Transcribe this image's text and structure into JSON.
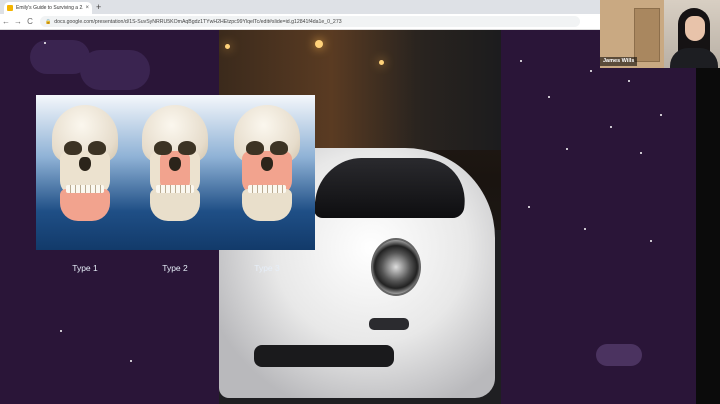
{
  "browser": {
    "tab_title": "Emily's Guide to Surviving a 2...",
    "tab_close": "×",
    "new_tab": "+",
    "back": "←",
    "forward": "→",
    "reload": "C",
    "url": "docs.google.com/presentation/d/1S-SuvSyNRRU5KOmAqBgdz1TYwH2HEtzpc99YlqelTc/edit#slide=id.g12841f4da1e_0_273"
  },
  "slide": {
    "skull_labels": [
      "Type 1",
      "Type 2",
      "Type 3"
    ],
    "colors": {
      "background": "#2a1538",
      "highlight": "#f2a38e"
    }
  },
  "video": {
    "participant_name": "James Wills"
  }
}
